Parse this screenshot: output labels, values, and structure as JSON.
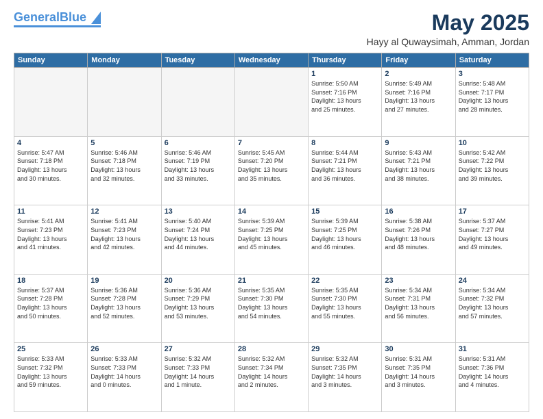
{
  "header": {
    "logo_general": "General",
    "logo_blue": "Blue",
    "month_title": "May 2025",
    "subtitle": "Hayy al Quwaysimah, Amman, Jordan"
  },
  "days_of_week": [
    "Sunday",
    "Monday",
    "Tuesday",
    "Wednesday",
    "Thursday",
    "Friday",
    "Saturday"
  ],
  "weeks": [
    [
      {
        "day": "",
        "info": ""
      },
      {
        "day": "",
        "info": ""
      },
      {
        "day": "",
        "info": ""
      },
      {
        "day": "",
        "info": ""
      },
      {
        "day": "1",
        "info": "Sunrise: 5:50 AM\nSunset: 7:16 PM\nDaylight: 13 hours\nand 25 minutes."
      },
      {
        "day": "2",
        "info": "Sunrise: 5:49 AM\nSunset: 7:16 PM\nDaylight: 13 hours\nand 27 minutes."
      },
      {
        "day": "3",
        "info": "Sunrise: 5:48 AM\nSunset: 7:17 PM\nDaylight: 13 hours\nand 28 minutes."
      }
    ],
    [
      {
        "day": "4",
        "info": "Sunrise: 5:47 AM\nSunset: 7:18 PM\nDaylight: 13 hours\nand 30 minutes."
      },
      {
        "day": "5",
        "info": "Sunrise: 5:46 AM\nSunset: 7:18 PM\nDaylight: 13 hours\nand 32 minutes."
      },
      {
        "day": "6",
        "info": "Sunrise: 5:46 AM\nSunset: 7:19 PM\nDaylight: 13 hours\nand 33 minutes."
      },
      {
        "day": "7",
        "info": "Sunrise: 5:45 AM\nSunset: 7:20 PM\nDaylight: 13 hours\nand 35 minutes."
      },
      {
        "day": "8",
        "info": "Sunrise: 5:44 AM\nSunset: 7:21 PM\nDaylight: 13 hours\nand 36 minutes."
      },
      {
        "day": "9",
        "info": "Sunrise: 5:43 AM\nSunset: 7:21 PM\nDaylight: 13 hours\nand 38 minutes."
      },
      {
        "day": "10",
        "info": "Sunrise: 5:42 AM\nSunset: 7:22 PM\nDaylight: 13 hours\nand 39 minutes."
      }
    ],
    [
      {
        "day": "11",
        "info": "Sunrise: 5:41 AM\nSunset: 7:23 PM\nDaylight: 13 hours\nand 41 minutes."
      },
      {
        "day": "12",
        "info": "Sunrise: 5:41 AM\nSunset: 7:23 PM\nDaylight: 13 hours\nand 42 minutes."
      },
      {
        "day": "13",
        "info": "Sunrise: 5:40 AM\nSunset: 7:24 PM\nDaylight: 13 hours\nand 44 minutes."
      },
      {
        "day": "14",
        "info": "Sunrise: 5:39 AM\nSunset: 7:25 PM\nDaylight: 13 hours\nand 45 minutes."
      },
      {
        "day": "15",
        "info": "Sunrise: 5:39 AM\nSunset: 7:25 PM\nDaylight: 13 hours\nand 46 minutes."
      },
      {
        "day": "16",
        "info": "Sunrise: 5:38 AM\nSunset: 7:26 PM\nDaylight: 13 hours\nand 48 minutes."
      },
      {
        "day": "17",
        "info": "Sunrise: 5:37 AM\nSunset: 7:27 PM\nDaylight: 13 hours\nand 49 minutes."
      }
    ],
    [
      {
        "day": "18",
        "info": "Sunrise: 5:37 AM\nSunset: 7:28 PM\nDaylight: 13 hours\nand 50 minutes."
      },
      {
        "day": "19",
        "info": "Sunrise: 5:36 AM\nSunset: 7:28 PM\nDaylight: 13 hours\nand 52 minutes."
      },
      {
        "day": "20",
        "info": "Sunrise: 5:36 AM\nSunset: 7:29 PM\nDaylight: 13 hours\nand 53 minutes."
      },
      {
        "day": "21",
        "info": "Sunrise: 5:35 AM\nSunset: 7:30 PM\nDaylight: 13 hours\nand 54 minutes."
      },
      {
        "day": "22",
        "info": "Sunrise: 5:35 AM\nSunset: 7:30 PM\nDaylight: 13 hours\nand 55 minutes."
      },
      {
        "day": "23",
        "info": "Sunrise: 5:34 AM\nSunset: 7:31 PM\nDaylight: 13 hours\nand 56 minutes."
      },
      {
        "day": "24",
        "info": "Sunrise: 5:34 AM\nSunset: 7:32 PM\nDaylight: 13 hours\nand 57 minutes."
      }
    ],
    [
      {
        "day": "25",
        "info": "Sunrise: 5:33 AM\nSunset: 7:32 PM\nDaylight: 13 hours\nand 59 minutes."
      },
      {
        "day": "26",
        "info": "Sunrise: 5:33 AM\nSunset: 7:33 PM\nDaylight: 14 hours\nand 0 minutes."
      },
      {
        "day": "27",
        "info": "Sunrise: 5:32 AM\nSunset: 7:33 PM\nDaylight: 14 hours\nand 1 minute."
      },
      {
        "day": "28",
        "info": "Sunrise: 5:32 AM\nSunset: 7:34 PM\nDaylight: 14 hours\nand 2 minutes."
      },
      {
        "day": "29",
        "info": "Sunrise: 5:32 AM\nSunset: 7:35 PM\nDaylight: 14 hours\nand 3 minutes."
      },
      {
        "day": "30",
        "info": "Sunrise: 5:31 AM\nSunset: 7:35 PM\nDaylight: 14 hours\nand 3 minutes."
      },
      {
        "day": "31",
        "info": "Sunrise: 5:31 AM\nSunset: 7:36 PM\nDaylight: 14 hours\nand 4 minutes."
      }
    ]
  ]
}
